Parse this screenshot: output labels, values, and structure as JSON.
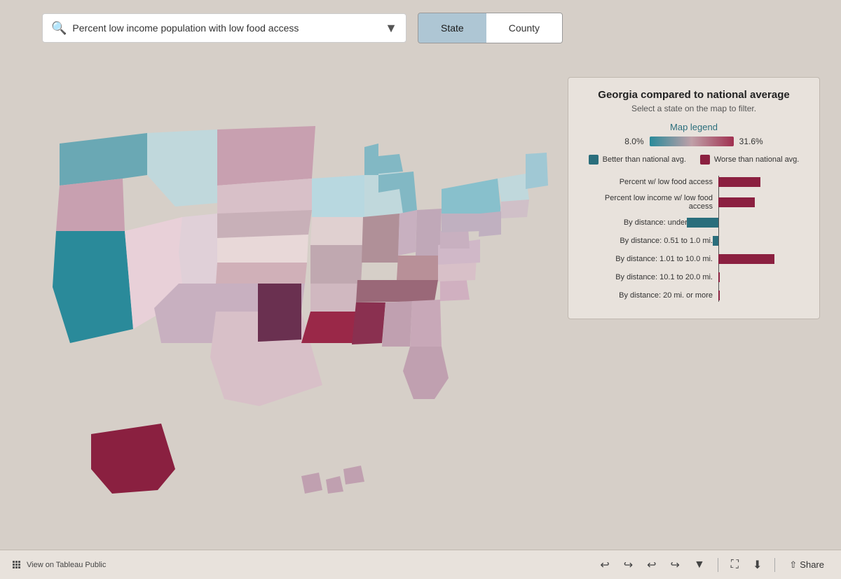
{
  "header": {
    "search_placeholder": "Percent low income population with low food access",
    "tab_state_label": "State",
    "tab_county_label": "County",
    "active_tab": "state"
  },
  "panel": {
    "title": "Georgia compared to national average",
    "subtitle": "Select a state on the map to filter.",
    "legend_title": "Map legend",
    "legend_min": "8.0%",
    "legend_max": "31.6%",
    "legend_better": "Better than national avg.",
    "legend_worse": "Worse than national avg.",
    "chart_rows": [
      {
        "label": "Percent w/ low food access",
        "value": 60,
        "positive": true
      },
      {
        "label": "Percent low income w/ low food access",
        "value": 55,
        "positive": true
      },
      {
        "label": "By distance: under 0.5 mi.",
        "value": -45,
        "positive": false
      },
      {
        "label": "By distance: 0.51 to 1.0 mi.",
        "value": -8,
        "positive": false
      },
      {
        "label": "By distance: 1.01 to 10.0 mi.",
        "value": 80,
        "positive": true
      },
      {
        "label": "By distance: 10.1 to 20.0 mi.",
        "value": 0,
        "positive": true
      },
      {
        "label": "By distance: 20 mi. or more",
        "value": 0,
        "positive": true
      }
    ]
  },
  "toolbar": {
    "tableau_label": "View on Tableau Public",
    "share_label": "Share",
    "undo_icon": "↩",
    "redo_icon": "↪",
    "back_icon": "↩",
    "forward_icon": "↪",
    "fullscreen_icon": "⛶",
    "download_icon": "⬇"
  }
}
